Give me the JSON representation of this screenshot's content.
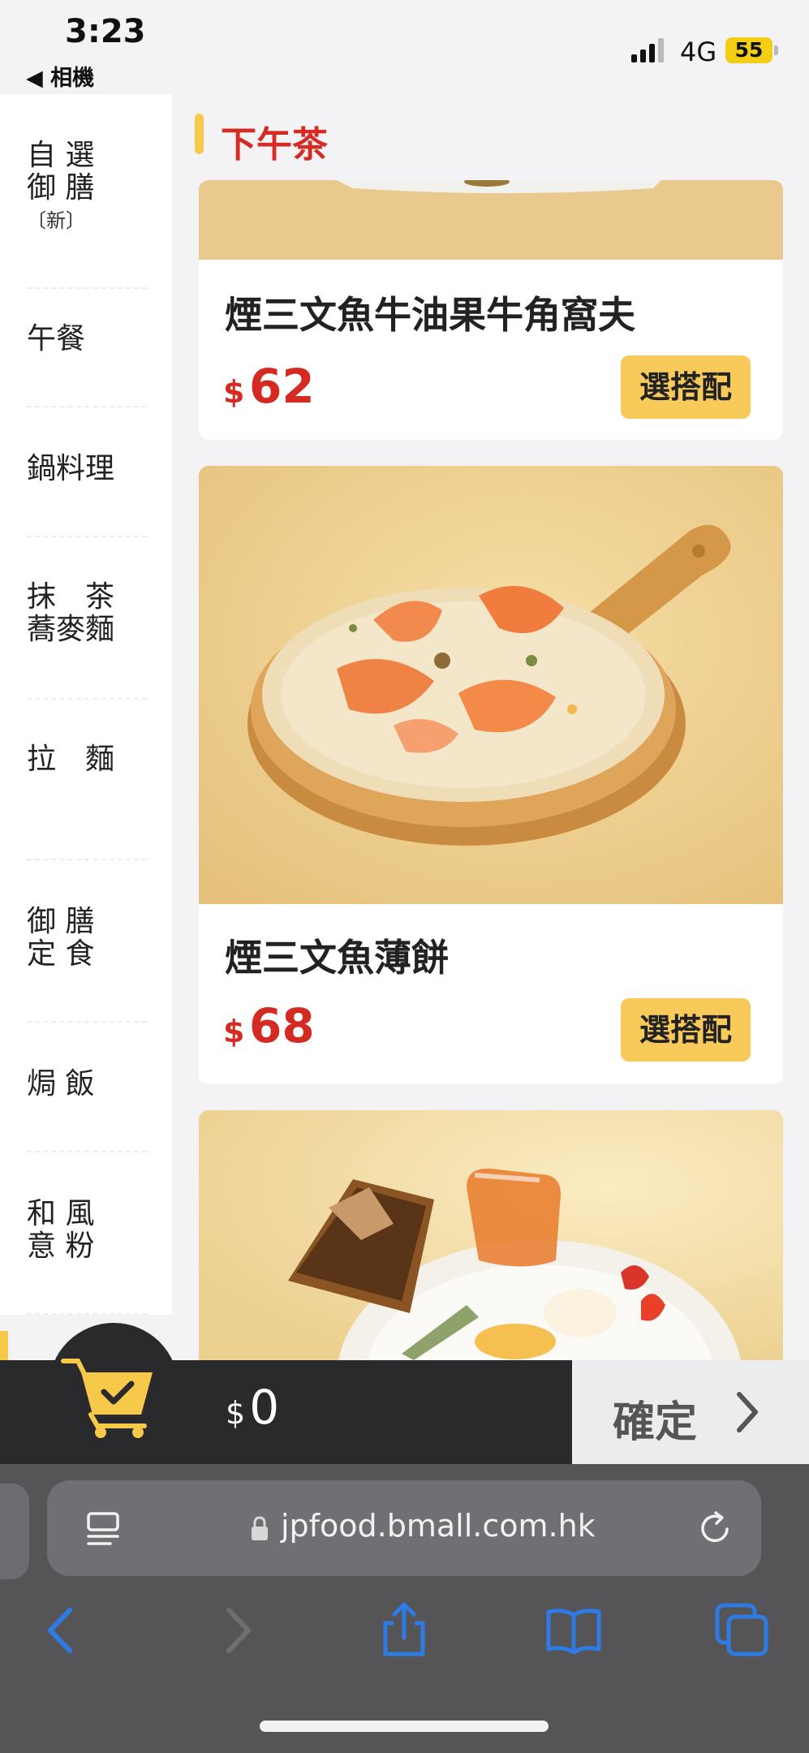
{
  "status_bar": {
    "time": "3:23",
    "back_label": "◀ 相機",
    "network": "4G",
    "battery": "55"
  },
  "sidebar": {
    "items": [
      {
        "line1": "自 選",
        "line2": "御 膳",
        "sub": "〔新〕"
      },
      {
        "label": "午餐"
      },
      {
        "label": "鍋料理"
      },
      {
        "line1": "抹　茶",
        "line2": "蕎麥麵"
      },
      {
        "label": "拉　麵"
      },
      {
        "line1": "御 膳",
        "line2": "定 食"
      },
      {
        "label": "焗 飯"
      },
      {
        "line1": "和 風",
        "line2": "意 粉"
      }
    ]
  },
  "section": {
    "title": "下午茶"
  },
  "menu": {
    "currency": "$",
    "combo_label": "選搭配",
    "items": [
      {
        "name": "煙三文魚牛油果牛角窩夫",
        "price": "62"
      },
      {
        "name": "煙三文魚薄餅",
        "price": "68"
      }
    ]
  },
  "cart": {
    "currency": "$",
    "total": "0",
    "confirm_label": "確定"
  },
  "browser": {
    "url": "jpfood.bmall.com.hk"
  },
  "colors": {
    "accent_red": "#d62b23",
    "accent_yellow": "#f6c94a",
    "button_yellow": "#f8ca5a",
    "cart_dark": "#2a2a2c",
    "safari_blue": "#2f7be6"
  },
  "icons": [
    "signal-icon",
    "battery-icon",
    "cart-icon",
    "chevron-right-icon",
    "reader-icon",
    "lock-icon",
    "reload-icon",
    "back-arrow-icon",
    "forward-arrow-icon",
    "share-icon",
    "bookmarks-icon",
    "tabs-icon"
  ]
}
